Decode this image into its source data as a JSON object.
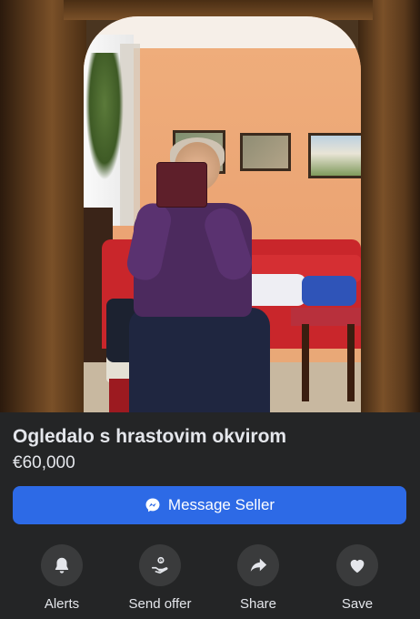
{
  "listing": {
    "title": "Ogledalo s hrastovim okvirom",
    "price": "€60,000",
    "photo_description_icon": "listing-photo"
  },
  "message_button": {
    "label": "Message Seller",
    "icon": "messenger-icon",
    "color": "#2d6ae6"
  },
  "actions": [
    {
      "label": "Alerts",
      "icon": "bell-icon"
    },
    {
      "label": "Send offer",
      "icon": "send-offer-icon"
    },
    {
      "label": "Share",
      "icon": "share-arrow-icon"
    },
    {
      "label": "Save",
      "icon": "heart-icon"
    }
  ],
  "colors": {
    "background": "#242526",
    "text": "#e4e6eb",
    "action_circle": "#3a3b3c"
  }
}
